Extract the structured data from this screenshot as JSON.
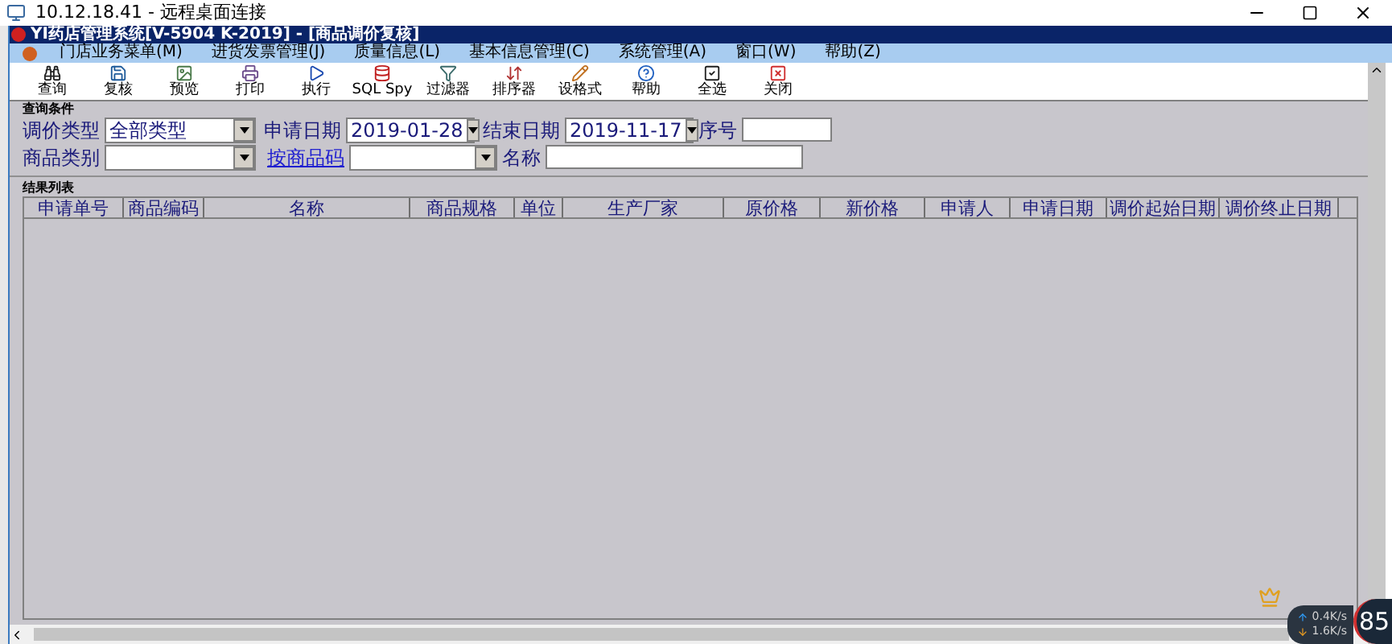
{
  "remote_window": {
    "title": "10.12.18.41 - 远程桌面连接"
  },
  "app": {
    "title": "YI药店管理系统[V-5904 K-2019] - [商品调价复核]"
  },
  "menu": [
    "门店业务菜单(M)",
    "进货发票管理(J)",
    "质量信息(L)",
    "基本信息管理(C)",
    "系统管理(A)",
    "窗口(W)",
    "帮助(Z)"
  ],
  "toolbar": [
    "查询",
    "复核",
    "预览",
    "打印",
    "执行",
    "SQL Spy",
    "过滤器",
    "排序器",
    "设格式",
    "帮助",
    "全选",
    "关闭"
  ],
  "query": {
    "title": "查询条件",
    "price_type": {
      "label": "调价类型",
      "value": "全部类型"
    },
    "apply_date": {
      "label": "申请日期",
      "value": "2019-01-28"
    },
    "end_date": {
      "label": "结束日期",
      "value": "2019-11-17"
    },
    "serial": {
      "label": "序号"
    },
    "category": {
      "label": "商品类别"
    },
    "code_link": {
      "label": "按商品码"
    },
    "name": {
      "label": "名称"
    }
  },
  "results": {
    "title": "结果列表",
    "columns": [
      "申请单号",
      "商品编码",
      "名称",
      "商品规格",
      "单位",
      "生产厂家",
      "原价格",
      "新价格",
      "申请人",
      "申请日期",
      "调价起始日期",
      "调价终止日期"
    ]
  },
  "tray": {
    "upload": "0.4K/s",
    "download": "1.6K/s",
    "score": "85"
  }
}
